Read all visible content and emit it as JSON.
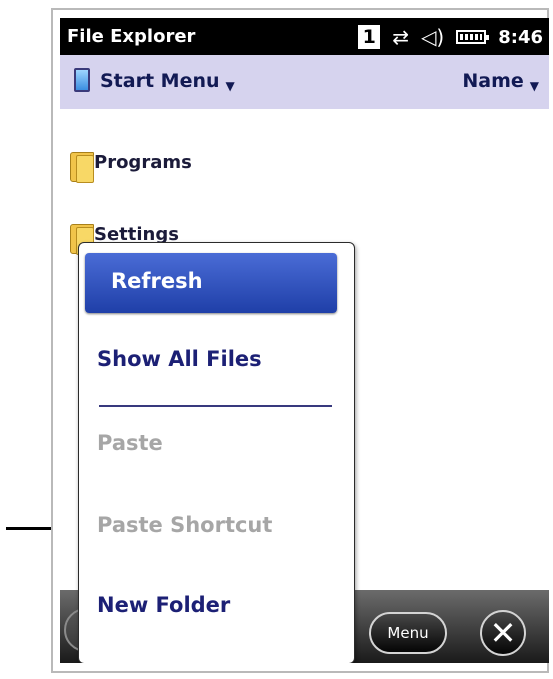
{
  "window": {
    "title": "File Explorer"
  },
  "status": {
    "badge": "1",
    "time": "8:46",
    "icons": [
      "connectivity-icon",
      "speaker-icon",
      "battery-icon"
    ]
  },
  "pathbar": {
    "location": "Start Menu",
    "sort": "Name"
  },
  "files": [
    {
      "name": "Programs"
    },
    {
      "name": "Settings"
    }
  ],
  "menu": {
    "items": [
      {
        "label": "Refresh",
        "state": "selected"
      },
      {
        "label": "Show All Files",
        "state": "enabled"
      },
      {
        "label": "Paste",
        "state": "disabled"
      },
      {
        "label": "Paste Shortcut",
        "state": "disabled"
      },
      {
        "label": "New Folder",
        "state": "enabled"
      }
    ]
  },
  "softkeys": {
    "menu": "Menu"
  },
  "colors": {
    "accent": "#2a4cc0",
    "menu_text": "#1c2075",
    "disabled_text": "#a6a6a6",
    "pathbar_bg": "#d6d3ee"
  }
}
